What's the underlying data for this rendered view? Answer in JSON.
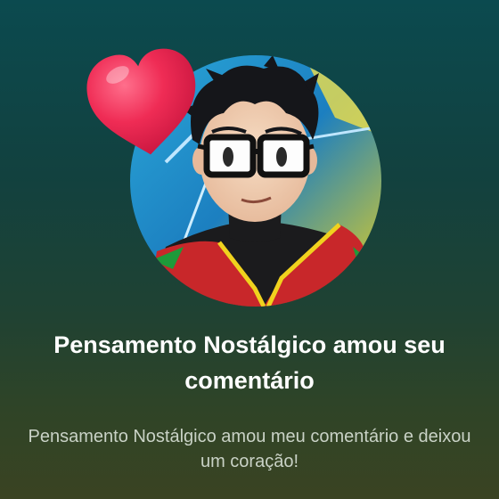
{
  "notification": {
    "title": "Pensamento Nostálgico amou seu comentário",
    "message": "Pensamento Nostálgico amou meu comentário e deixou um coração!"
  },
  "icons": {
    "heart": "heart-icon",
    "avatar": "user-avatar"
  },
  "colors": {
    "heart": "#e8234f",
    "title_text": "#ffffff",
    "message_text": "#c9d2c6"
  }
}
